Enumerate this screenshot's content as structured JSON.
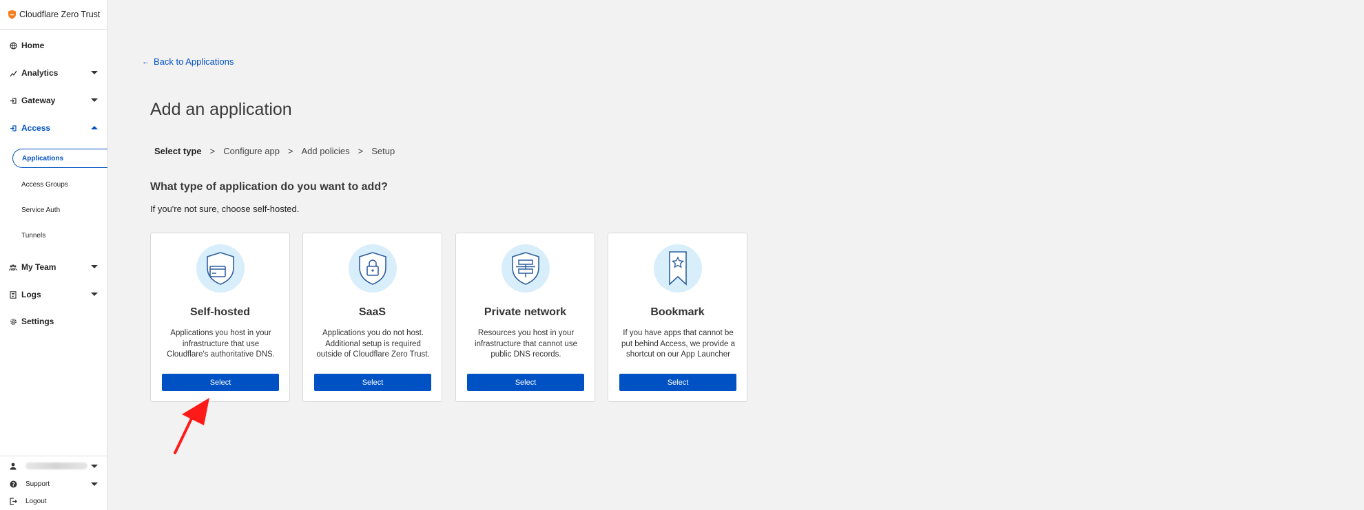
{
  "app": {
    "title": "Cloudflare Zero Trust"
  },
  "sidebar": {
    "items": [
      {
        "label": "Home",
        "icon": "home-icon"
      },
      {
        "label": "Analytics",
        "icon": "analytics-icon"
      },
      {
        "label": "Gateway",
        "icon": "gateway-icon"
      },
      {
        "label": "Access",
        "icon": "access-icon",
        "expanded": true
      },
      {
        "label": "My Team",
        "icon": "team-icon"
      },
      {
        "label": "Logs",
        "icon": "logs-icon"
      },
      {
        "label": "Settings",
        "icon": "settings-icon"
      }
    ],
    "access_subitems": [
      {
        "label": "Applications",
        "selected": true
      },
      {
        "label": "Access Groups"
      },
      {
        "label": "Service Auth"
      },
      {
        "label": "Tunnels"
      }
    ],
    "bottom": {
      "support": "Support",
      "logout": "Logout"
    }
  },
  "main": {
    "back_link": "Back to Applications",
    "title": "Add an application",
    "steps": [
      "Select type",
      "Configure app",
      "Add policies",
      "Setup"
    ],
    "step_separator": ">",
    "question": "What type of application do you want to add?",
    "hint": "If you're not sure, choose self-hosted.",
    "cards": [
      {
        "title": "Self-hosted",
        "description": "Applications you host in your infrastructure that use Cloudflare's authoritative DNS.",
        "button": "Select",
        "icon": "shield-card-icon"
      },
      {
        "title": "SaaS",
        "description": "Applications you do not host. Additional setup is required outside of Cloudflare Zero Trust.",
        "button": "Select",
        "icon": "shield-lock-icon"
      },
      {
        "title": "Private network",
        "description": "Resources you host in your infrastructure that cannot use public DNS records.",
        "button": "Select",
        "icon": "shield-network-icon"
      },
      {
        "title": "Bookmark",
        "description": "If you have apps that cannot be put behind Access, we provide a shortcut on our App Launcher",
        "button": "Select",
        "icon": "bookmark-star-icon"
      }
    ]
  },
  "colors": {
    "accent": "#0051c3",
    "brand_orange": "#f38020",
    "icon_circle": "#d8eefb",
    "annotation": "#ff1a1a"
  }
}
